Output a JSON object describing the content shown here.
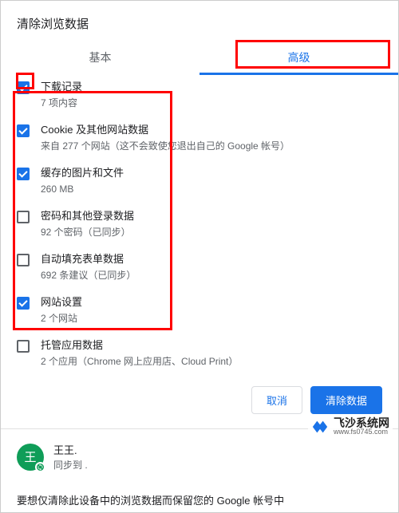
{
  "dialog": {
    "title": "清除浏览数据",
    "tabs": {
      "basic": "基本",
      "advanced": "高级"
    },
    "items": [
      {
        "checked": true,
        "title": "下载记录",
        "desc": "7 项内容"
      },
      {
        "checked": true,
        "title": "Cookie 及其他网站数据",
        "desc": "来自 277 个网站（这不会致使您退出自己的 Google 帐号）"
      },
      {
        "checked": true,
        "title": "缓存的图片和文件",
        "desc": "260 MB"
      },
      {
        "checked": false,
        "title": "密码和其他登录数据",
        "desc": "92 个密码（已同步）"
      },
      {
        "checked": false,
        "title": "自动填充表单数据",
        "desc": "692 条建议（已同步）"
      },
      {
        "checked": true,
        "title": "网站设置",
        "desc": "2 个网站"
      },
      {
        "checked": false,
        "title": "托管应用数据",
        "desc": "2 个应用（Chrome 网上应用店、Cloud Print）"
      }
    ],
    "buttons": {
      "cancel": "取消",
      "confirm": "清除数据"
    },
    "profile": {
      "avatar_letter": "王",
      "name": "王王.",
      "sync": "同步到 ."
    },
    "footer": "要想仅清除此设备中的浏览数据而保留您的 Google 帐号中"
  },
  "watermark": {
    "zh": "飞沙系统网",
    "en": "www.fs0745.com"
  }
}
